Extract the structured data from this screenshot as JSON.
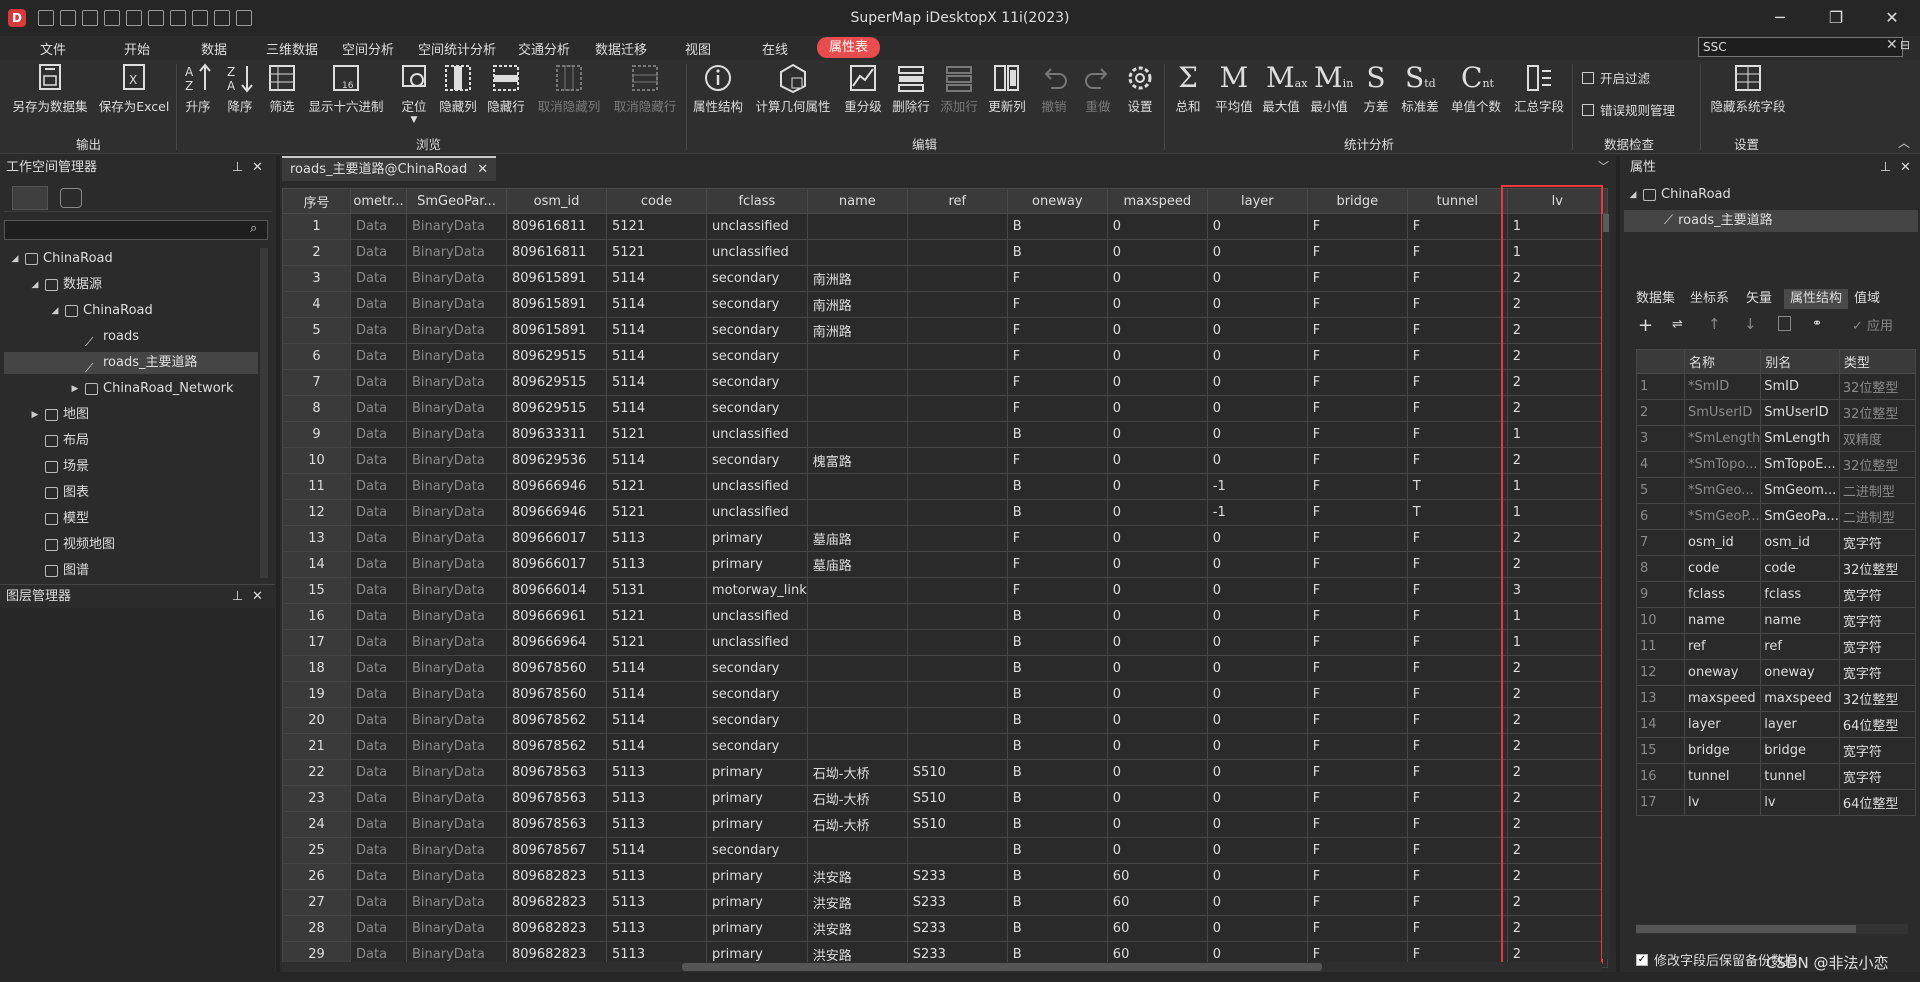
{
  "window": {
    "title": "SuperMap iDesktopX 11i(2023)",
    "logo": "D",
    "minimize": "─",
    "maximize": "❐",
    "close": "✕"
  },
  "menu": [
    "文件",
    "开始",
    "数据",
    "三维数据",
    "空间分析",
    "空间统计分析",
    "交通分析",
    "数据迁移",
    "视图",
    "在线",
    "属性表"
  ],
  "search": {
    "value": "SSC",
    "clear": "✕",
    "pin": "⊟"
  },
  "ribbon": {
    "export": [
      {
        "label": "另存为数据集",
        "icon": "save-dataset-icon"
      },
      {
        "label": "保存为Excel",
        "icon": "save-excel-icon"
      }
    ],
    "browse": [
      {
        "label": "升序",
        "icon": "sort-ascending-icon"
      },
      {
        "label": "降序",
        "icon": "sort-descending-icon"
      },
      {
        "label": "筛选",
        "icon": "filter-icon"
      },
      {
        "label": "显示十六进制",
        "icon": "hex-icon"
      },
      {
        "label": "定位",
        "icon": "locate-icon"
      },
      {
        "label": "隐藏列",
        "icon": "hide-column-icon"
      },
      {
        "label": "隐藏行",
        "icon": "hide-row-icon"
      },
      {
        "label": "取消隐藏列",
        "icon": "unhide-column-icon",
        "disabled": true
      },
      {
        "label": "取消隐藏行",
        "icon": "unhide-row-icon",
        "disabled": true
      }
    ],
    "edit": [
      {
        "label": "属性结构",
        "icon": "info-icon"
      },
      {
        "label": "计算几何属性",
        "icon": "calc-geometry-icon"
      },
      {
        "label": "重分级",
        "icon": "reclass-icon"
      },
      {
        "label": "删除行",
        "icon": "delete-row-icon"
      },
      {
        "label": "添加行",
        "icon": "add-row-icon",
        "disabled": true
      },
      {
        "label": "更新列",
        "icon": "update-column-icon"
      },
      {
        "label": "撤销",
        "icon": "undo-icon",
        "disabled": true
      },
      {
        "label": "重做",
        "icon": "redo-icon",
        "disabled": true
      },
      {
        "label": "设置",
        "icon": "gear-icon"
      }
    ],
    "stats": [
      {
        "label": "总和",
        "glyph": "Σ"
      },
      {
        "label": "平均值",
        "glyph": "M"
      },
      {
        "label": "最大值",
        "glyph": "M",
        "sub": "ax"
      },
      {
        "label": "最小值",
        "glyph": "M",
        "sub": "in"
      },
      {
        "label": "方差",
        "glyph": "S"
      },
      {
        "label": "标准差",
        "glyph": "S",
        "sub": "td"
      },
      {
        "label": "单值个数",
        "glyph": "C",
        "sub": "nt"
      },
      {
        "label": "汇总字段",
        "icon": "summary-field-icon"
      }
    ],
    "check": [
      {
        "label": "开启过滤"
      },
      {
        "label": "错误规则管理"
      }
    ],
    "settings": [
      {
        "label": "隐藏系统字段",
        "icon": "hide-system-field-icon"
      }
    ],
    "groups": {
      "export": "输出",
      "browse": "浏览",
      "edit": "编辑",
      "stats": "统计分析",
      "check": "数据检查",
      "settings": "设置"
    }
  },
  "workspace": {
    "title": "工作空间管理器",
    "pin": "⊥",
    "close": "✕",
    "tree": [
      {
        "label": "ChinaRoad",
        "level": 0,
        "arrow": "◢"
      },
      {
        "label": "数据源",
        "level": 1,
        "arrow": "◢"
      },
      {
        "label": "ChinaRoad",
        "level": 2,
        "arrow": "◢"
      },
      {
        "label": "roads",
        "level": 3,
        "arrow": ""
      },
      {
        "label": "roads_主要道路",
        "level": 3,
        "arrow": "",
        "selected": true
      },
      {
        "label": "ChinaRoad_Network",
        "level": 3,
        "arrow": "▶"
      },
      {
        "label": "地图",
        "level": 1,
        "arrow": "▶"
      },
      {
        "label": "布局",
        "level": 1,
        "arrow": ""
      },
      {
        "label": "场景",
        "level": 1,
        "arrow": ""
      },
      {
        "label": "图表",
        "level": 1,
        "arrow": ""
      },
      {
        "label": "模型",
        "level": 1,
        "arrow": ""
      },
      {
        "label": "视频地图",
        "level": 1,
        "arrow": ""
      },
      {
        "label": "图谱",
        "level": 1,
        "arrow": ""
      }
    ]
  },
  "layers": {
    "title": "图层管理器",
    "pin": "⊥",
    "close": "✕"
  },
  "doc_tab": {
    "label": "roads_主要道路@ChinaRoad",
    "close": "✕"
  },
  "table": {
    "columns": [
      "序号",
      "ometr...",
      "SmGeoPar...",
      "osm_id",
      "code",
      "fclass",
      "name",
      "ref",
      "oneway",
      "maxspeed",
      "layer",
      "bridge",
      "tunnel",
      "lv"
    ],
    "rows": [
      [
        "1",
        "Data",
        "BinaryData",
        "809616811",
        "5121",
        "unclassified",
        "",
        "",
        "B",
        "0",
        "0",
        "F",
        "F",
        "1"
      ],
      [
        "2",
        "Data",
        "BinaryData",
        "809616811",
        "5121",
        "unclassified",
        "",
        "",
        "B",
        "0",
        "0",
        "F",
        "F",
        "1"
      ],
      [
        "3",
        "Data",
        "BinaryData",
        "809615891",
        "5114",
        "secondary",
        "南洲路",
        "",
        "F",
        "0",
        "0",
        "F",
        "F",
        "2"
      ],
      [
        "4",
        "Data",
        "BinaryData",
        "809615891",
        "5114",
        "secondary",
        "南洲路",
        "",
        "F",
        "0",
        "0",
        "F",
        "F",
        "2"
      ],
      [
        "5",
        "Data",
        "BinaryData",
        "809615891",
        "5114",
        "secondary",
        "南洲路",
        "",
        "F",
        "0",
        "0",
        "F",
        "F",
        "2"
      ],
      [
        "6",
        "Data",
        "BinaryData",
        "809629515",
        "5114",
        "secondary",
        "",
        "",
        "F",
        "0",
        "0",
        "F",
        "F",
        "2"
      ],
      [
        "7",
        "Data",
        "BinaryData",
        "809629515",
        "5114",
        "secondary",
        "",
        "",
        "F",
        "0",
        "0",
        "F",
        "F",
        "2"
      ],
      [
        "8",
        "Data",
        "BinaryData",
        "809629515",
        "5114",
        "secondary",
        "",
        "",
        "F",
        "0",
        "0",
        "F",
        "F",
        "2"
      ],
      [
        "9",
        "Data",
        "BinaryData",
        "809633311",
        "5121",
        "unclassified",
        "",
        "",
        "B",
        "0",
        "0",
        "F",
        "F",
        "1"
      ],
      [
        "10",
        "Data",
        "BinaryData",
        "809629536",
        "5114",
        "secondary",
        "槐富路",
        "",
        "F",
        "0",
        "0",
        "F",
        "F",
        "2"
      ],
      [
        "11",
        "Data",
        "BinaryData",
        "809666946",
        "5121",
        "unclassified",
        "",
        "",
        "B",
        "0",
        "-1",
        "F",
        "T",
        "1"
      ],
      [
        "12",
        "Data",
        "BinaryData",
        "809666946",
        "5121",
        "unclassified",
        "",
        "",
        "B",
        "0",
        "-1",
        "F",
        "T",
        "1"
      ],
      [
        "13",
        "Data",
        "BinaryData",
        "809666017",
        "5113",
        "primary",
        "墓庙路",
        "",
        "F",
        "0",
        "0",
        "F",
        "F",
        "2"
      ],
      [
        "14",
        "Data",
        "BinaryData",
        "809666017",
        "5113",
        "primary",
        "墓庙路",
        "",
        "F",
        "0",
        "0",
        "F",
        "F",
        "2"
      ],
      [
        "15",
        "Data",
        "BinaryData",
        "809666014",
        "5131",
        "motorway_link",
        "",
        "",
        "F",
        "0",
        "0",
        "F",
        "F",
        "3"
      ],
      [
        "16",
        "Data",
        "BinaryData",
        "809666961",
        "5121",
        "unclassified",
        "",
        "",
        "B",
        "0",
        "0",
        "F",
        "F",
        "1"
      ],
      [
        "17",
        "Data",
        "BinaryData",
        "809666964",
        "5121",
        "unclassified",
        "",
        "",
        "B",
        "0",
        "0",
        "F",
        "F",
        "1"
      ],
      [
        "18",
        "Data",
        "BinaryData",
        "809678560",
        "5114",
        "secondary",
        "",
        "",
        "B",
        "0",
        "0",
        "F",
        "F",
        "2"
      ],
      [
        "19",
        "Data",
        "BinaryData",
        "809678560",
        "5114",
        "secondary",
        "",
        "",
        "B",
        "0",
        "0",
        "F",
        "F",
        "2"
      ],
      [
        "20",
        "Data",
        "BinaryData",
        "809678562",
        "5114",
        "secondary",
        "",
        "",
        "B",
        "0",
        "0",
        "F",
        "F",
        "2"
      ],
      [
        "21",
        "Data",
        "BinaryData",
        "809678562",
        "5114",
        "secondary",
        "",
        "",
        "B",
        "0",
        "0",
        "F",
        "F",
        "2"
      ],
      [
        "22",
        "Data",
        "BinaryData",
        "809678563",
        "5113",
        "primary",
        "石坳-大桥",
        "S510",
        "B",
        "0",
        "0",
        "F",
        "F",
        "2"
      ],
      [
        "23",
        "Data",
        "BinaryData",
        "809678563",
        "5113",
        "primary",
        "石坳-大桥",
        "S510",
        "B",
        "0",
        "0",
        "F",
        "F",
        "2"
      ],
      [
        "24",
        "Data",
        "BinaryData",
        "809678563",
        "5113",
        "primary",
        "石坳-大桥",
        "S510",
        "B",
        "0",
        "0",
        "F",
        "F",
        "2"
      ],
      [
        "25",
        "Data",
        "BinaryData",
        "809678567",
        "5114",
        "secondary",
        "",
        "",
        "B",
        "0",
        "0",
        "F",
        "F",
        "2"
      ],
      [
        "26",
        "Data",
        "BinaryData",
        "809682823",
        "5113",
        "primary",
        "洪安路",
        "S233",
        "B",
        "60",
        "0",
        "F",
        "F",
        "2"
      ],
      [
        "27",
        "Data",
        "BinaryData",
        "809682823",
        "5113",
        "primary",
        "洪安路",
        "S233",
        "B",
        "60",
        "0",
        "F",
        "F",
        "2"
      ],
      [
        "28",
        "Data",
        "BinaryData",
        "809682823",
        "5113",
        "primary",
        "洪安路",
        "S233",
        "B",
        "60",
        "0",
        "F",
        "F",
        "2"
      ],
      [
        "29",
        "Data",
        "BinaryData",
        "809682823",
        "5113",
        "primary",
        "洪安路",
        "S233",
        "B",
        "60",
        "0",
        "F",
        "F",
        "2"
      ]
    ]
  },
  "properties": {
    "title": "属性",
    "pin": "⊥",
    "close": "✕",
    "tree": [
      {
        "label": "ChinaRoad",
        "arrow": "◢"
      },
      {
        "label": "roads_主要道路",
        "arrow": ""
      }
    ],
    "tabs": [
      "数据集",
      "坐标系",
      "矢量",
      "属性结构",
      "值域"
    ],
    "active_tab": 3,
    "apply": "✓ 应用",
    "columns": [
      "",
      "名称",
      "别名",
      "类型"
    ],
    "fields": [
      [
        "1",
        "*SmID",
        "SmID",
        "32位整型"
      ],
      [
        "2",
        "SmUserID",
        "SmUserID",
        "32位整型"
      ],
      [
        "3",
        "*SmLength",
        "SmLength",
        "双精度"
      ],
      [
        "4",
        "*SmTopo...",
        "SmTopoE...",
        "32位整型"
      ],
      [
        "5",
        "*SmGeo...",
        "SmGeom...",
        "二进制型"
      ],
      [
        "6",
        "*SmGeoP...",
        "SmGeoPa...",
        "二进制型"
      ],
      [
        "7",
        "osm_id",
        "osm_id",
        "宽字符"
      ],
      [
        "8",
        "code",
        "code",
        "32位整型"
      ],
      [
        "9",
        "fclass",
        "fclass",
        "宽字符"
      ],
      [
        "10",
        "name",
        "name",
        "宽字符"
      ],
      [
        "11",
        "ref",
        "ref",
        "宽字符"
      ],
      [
        "12",
        "oneway",
        "oneway",
        "宽字符"
      ],
      [
        "13",
        "maxspeed",
        "maxspeed",
        "32位整型"
      ],
      [
        "14",
        "layer",
        "layer",
        "64位整型"
      ],
      [
        "15",
        "bridge",
        "bridge",
        "宽字符"
      ],
      [
        "16",
        "tunnel",
        "tunnel",
        "宽字符"
      ],
      [
        "17",
        "lv",
        "lv",
        "64位整型"
      ]
    ],
    "backup_label": "修改字段后保留备份数据",
    "backup_checked": "✓"
  },
  "watermark": "CSDN @非法小恋",
  "colors": {
    "accent": "#e84c4c",
    "highlight": "#e8393c"
  }
}
